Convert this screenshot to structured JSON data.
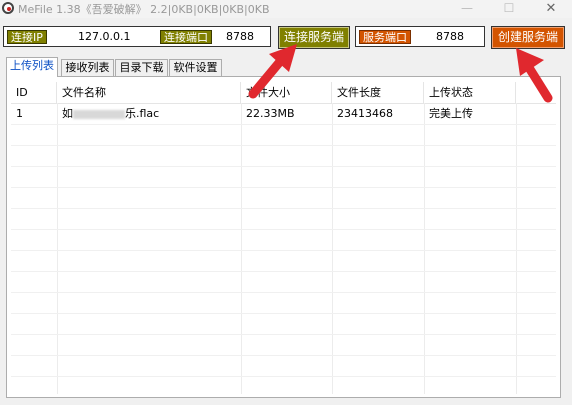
{
  "window": {
    "title": "MeFile 1.38《吾爱破解》   2.2|0KB|0KB|0KB|0KB",
    "min_glyph": "—",
    "max_glyph": "☐",
    "close_glyph": "✕"
  },
  "connect": {
    "ip_label": "连接IP",
    "ip_value": "127.0.0.1",
    "port_label": "连接端口",
    "port_value": "8788",
    "button_label": "连接服务端"
  },
  "server": {
    "port_label": "服务端口",
    "port_value": "8788",
    "button_label": "创建服务端"
  },
  "tabs": [
    {
      "label": "上传列表",
      "active": true
    },
    {
      "label": "接收列表",
      "active": false
    },
    {
      "label": "目录下载",
      "active": false
    },
    {
      "label": "软件设置",
      "active": false
    }
  ],
  "table": {
    "columns": [
      "ID",
      "文件名称",
      "文件大小",
      "文件长度",
      "上传状态"
    ],
    "rows": [
      {
        "id": "1",
        "name_prefix": "如",
        "name_suffix": "乐.flac",
        "size": "22.33MB",
        "length": "23413468",
        "status": "完美上传"
      }
    ]
  },
  "colors": {
    "accent_green": "#808000",
    "accent_orange": "#d35400",
    "arrow_red": "#e0282e",
    "active_tab_text": "#0a4ec4"
  }
}
